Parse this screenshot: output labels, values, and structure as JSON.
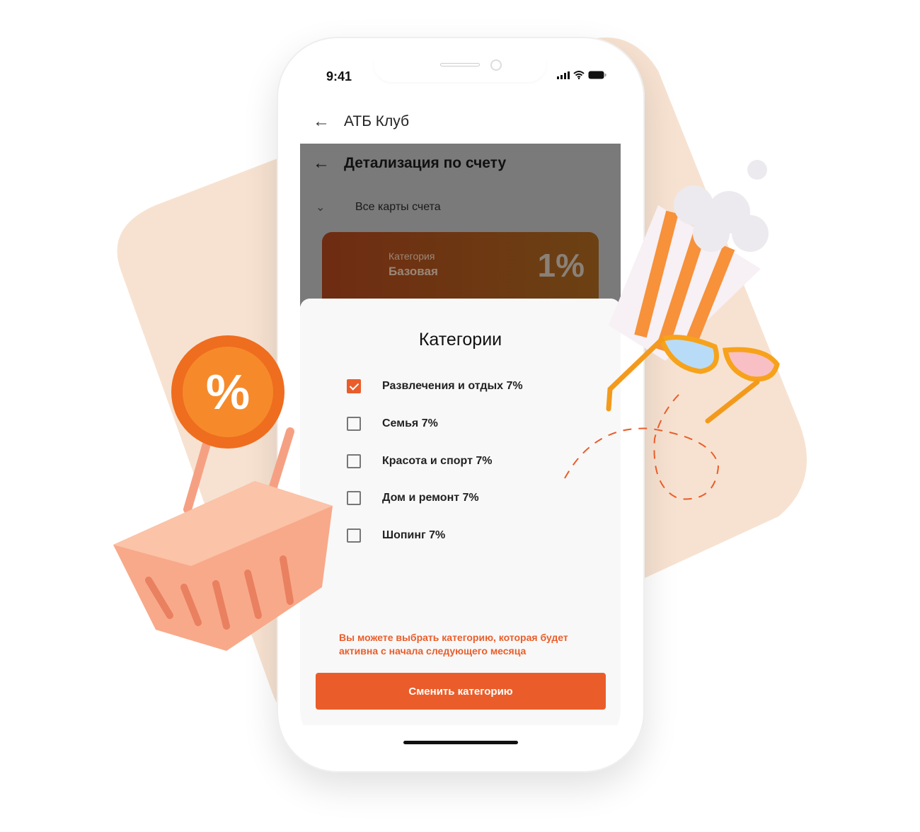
{
  "status_bar": {
    "time": "9:41"
  },
  "app_header": {
    "title": "АТБ Клуб"
  },
  "detail_screen": {
    "title": "Детализация по счету",
    "cards_selector": "Все карты счета",
    "card": {
      "label": "Категория",
      "value": "Базовая",
      "percent": "1%"
    }
  },
  "sheet": {
    "title": "Категории",
    "options": [
      {
        "label": "Развлечения и отдых 7%",
        "checked": true
      },
      {
        "label": "Семья 7%",
        "checked": false
      },
      {
        "label": "Красота и спорт 7%",
        "checked": false
      },
      {
        "label": "Дом и ремонт 7%",
        "checked": false
      },
      {
        "label": "Шопинг 7%",
        "checked": false
      }
    ],
    "note": "Вы можете выбрать категорию, которая будет активна с начала следующего месяца",
    "button": "Сменить категорию"
  },
  "colors": {
    "accent": "#ea5d2a",
    "background_blob": "#f7e2d1"
  },
  "decorations": {
    "coin_symbol": "%"
  }
}
